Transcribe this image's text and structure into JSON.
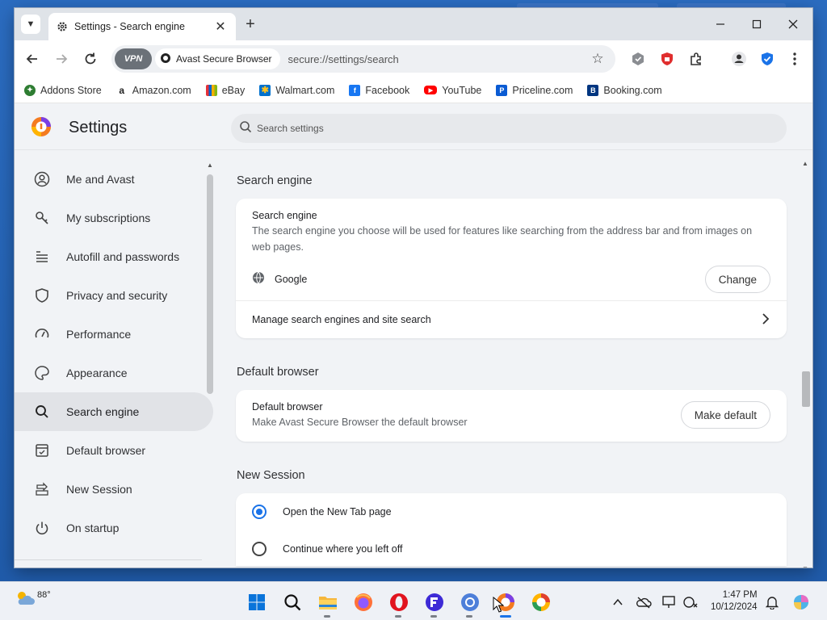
{
  "browser": {
    "tab_title": "Settings - Search engine",
    "site_chip": "Avast Secure Browser",
    "vpn_label": "VPN",
    "url": "secure://settings/search"
  },
  "bookmarks": [
    {
      "label": "Addons Store",
      "icon": "addons-store-icon",
      "color": "#2e7d32"
    },
    {
      "label": "Amazon.com",
      "icon": "amazon-icon",
      "color": "#222222"
    },
    {
      "label": "eBay",
      "icon": "ebay-icon",
      "color": "#e53238"
    },
    {
      "label": "Walmart.com",
      "icon": "walmart-icon",
      "color": "#0071ce"
    },
    {
      "label": "Facebook",
      "icon": "facebook-icon",
      "color": "#1877f2"
    },
    {
      "label": "YouTube",
      "icon": "youtube-icon",
      "color": "#ff0000"
    },
    {
      "label": "Priceline.com",
      "icon": "priceline-icon",
      "color": "#0a5bd3"
    },
    {
      "label": "Booking.com",
      "icon": "booking-icon",
      "color": "#003580"
    }
  ],
  "settings": {
    "title": "Settings",
    "search_placeholder": "Search settings"
  },
  "sidebar": {
    "items": [
      {
        "label": "Me and Avast",
        "icon": "person-icon"
      },
      {
        "label": "My subscriptions",
        "icon": "key-icon"
      },
      {
        "label": "Autofill and passwords",
        "icon": "list-icon"
      },
      {
        "label": "Privacy and security",
        "icon": "shield-icon"
      },
      {
        "label": "Performance",
        "icon": "speedometer-icon"
      },
      {
        "label": "Appearance",
        "icon": "palette-icon"
      },
      {
        "label": "Search engine",
        "icon": "search-icon",
        "active": true
      },
      {
        "label": "Default browser",
        "icon": "browser-icon"
      },
      {
        "label": "New Session",
        "icon": "power-icon"
      },
      {
        "label": "On startup",
        "icon": "power-icon"
      }
    ]
  },
  "main": {
    "search_engine": {
      "section_title": "Search engine",
      "row_title": "Search engine",
      "row_desc": "The search engine you choose will be used for features like searching from the address bar and from images on web pages.",
      "engine_name": "Google",
      "change_label": "Change",
      "manage_label": "Manage search engines and site search"
    },
    "default_browser": {
      "section_title": "Default browser",
      "row_title": "Default browser",
      "row_desc": "Make Avast Secure Browser the default browser",
      "button_label": "Make default"
    },
    "new_session": {
      "section_title": "New Session",
      "options": [
        {
          "label": "Open the New Tab page",
          "selected": true
        },
        {
          "label": "Continue where you left off",
          "selected": false
        }
      ]
    }
  },
  "taskbar": {
    "weather_temp": "88°",
    "time": "1:47 PM",
    "date": "10/12/2024"
  },
  "colors": {
    "accent": "#1a73e8",
    "active_nav": "#e1e3e7"
  }
}
